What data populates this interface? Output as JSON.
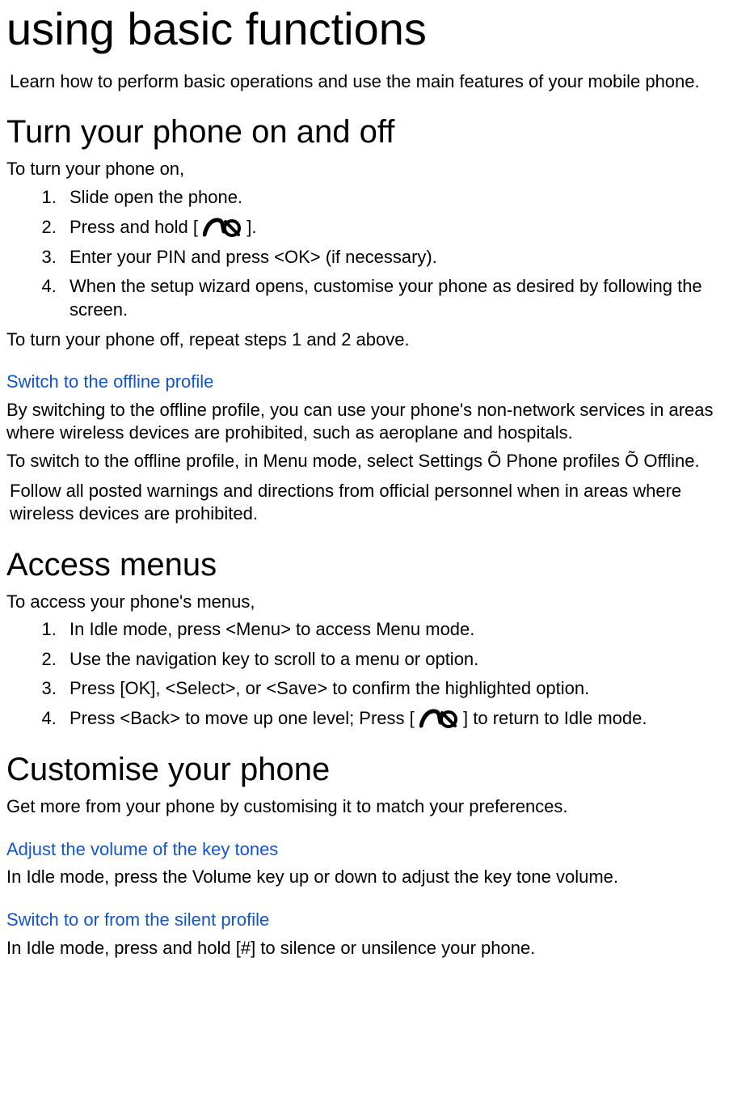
{
  "title": "using basic functions",
  "intro": "Learn how to perform basic operations and use the main features of your mobile phone.",
  "sections": {
    "s1": {
      "heading": "Turn your phone on and off",
      "p1": "To turn your phone on,",
      "steps": {
        "i1": "Slide open the phone.",
        "i2a": "Press and hold [ ",
        "i2b": " ].",
        "i3": "Enter your PIN and press <OK> (if necessary).",
        "i4": "When the setup wizard opens, customise your phone as desired by following the screen."
      },
      "p2": "To turn your phone off, repeat steps 1 and 2 above.",
      "sub1": {
        "heading": "Switch to the offline profile",
        "p1": "By switching to the offline profile, you can use your phone's non-network services in areas where wireless devices are prohibited, such as aeroplane and hospitals.",
        "p2": "To switch to the offline profile, in Menu mode, select Settings Õ Phone profiles Õ Offline.",
        "note": "Follow all posted warnings and directions from official personnel when in areas where wireless devices are prohibited."
      }
    },
    "s2": {
      "heading": "Access menus",
      "p1": "To access your phone's menus,",
      "steps": {
        "i1": "In Idle mode, press <Menu> to access Menu mode.",
        "i2": "Use the navigation key to scroll to a menu or option.",
        "i3": "Press [OK], <Select>, or <Save> to confirm the highlighted option.",
        "i4a": "Press <Back> to move up one level; Press [ ",
        "i4b": " ] to return to Idle mode."
      }
    },
    "s3": {
      "heading": "Customise your phone",
      "p1": "Get more from your phone by customising it to match your preferences.",
      "sub1": {
        "heading": "Adjust the volume of the key tones",
        "p1": "In Idle mode, press the Volume key up or down to adjust the key tone volume."
      },
      "sub2": {
        "heading": "Switch to or from the silent profile",
        "p1": "In Idle mode, press and hold [#] to silence or unsilence your phone."
      }
    }
  }
}
